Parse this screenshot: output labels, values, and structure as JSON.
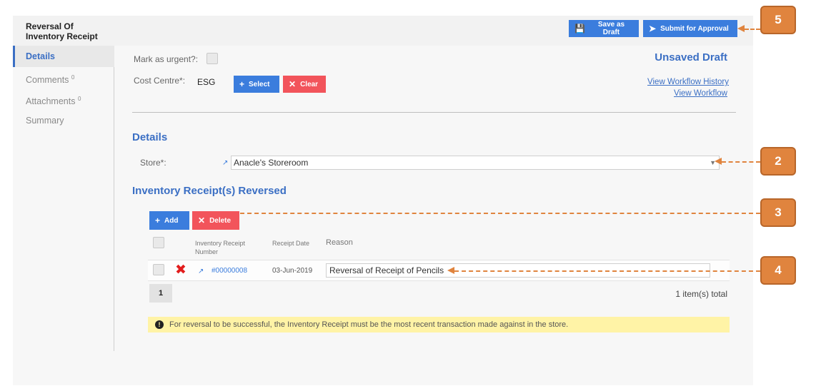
{
  "header": {
    "title": "Reversal Of Inventory Receipt",
    "save_label": "Save as Draft",
    "submit_label": "Submit for Approval"
  },
  "sidebar": {
    "items": [
      {
        "label": "Details",
        "count": ""
      },
      {
        "label": "Comments",
        "count": "0"
      },
      {
        "label": "Attachments",
        "count": "0"
      },
      {
        "label": "Summary",
        "count": ""
      }
    ]
  },
  "form": {
    "urgent_label": "Mark as urgent?:",
    "cost_centre_label": "Cost Centre*:",
    "cost_centre_value": "ESG",
    "select_label": "Select",
    "clear_label": "Clear",
    "status": "Unsaved Draft",
    "view_history_link": "View Workflow History",
    "view_workflow_link": "View Workflow"
  },
  "details": {
    "section_title": "Details",
    "store_label": "Store*:",
    "store_value": "Anacle's Storeroom"
  },
  "receipts": {
    "section_title": "Inventory Receipt(s) Reversed",
    "add_label": "Add",
    "delete_label": "Delete",
    "columns": [
      "Inventory Receipt Number",
      "Receipt Date",
      "Reason"
    ],
    "rows": [
      {
        "number": "#00000008",
        "date": "03-Jun-2019",
        "reason": "Reversal of Receipt of Pencils"
      }
    ],
    "page": "1",
    "total": "1 item(s) total"
  },
  "notice": {
    "icon": "!",
    "text": "For reversal to be successful, the Inventory Receipt must be the most recent transaction made against in the store."
  },
  "callouts": [
    "2",
    "3",
    "4",
    "5"
  ],
  "colors": {
    "accent": "#3b7ddd",
    "danger": "#f2545b",
    "callout": "#e0843e",
    "notice": "#fff3a6"
  }
}
